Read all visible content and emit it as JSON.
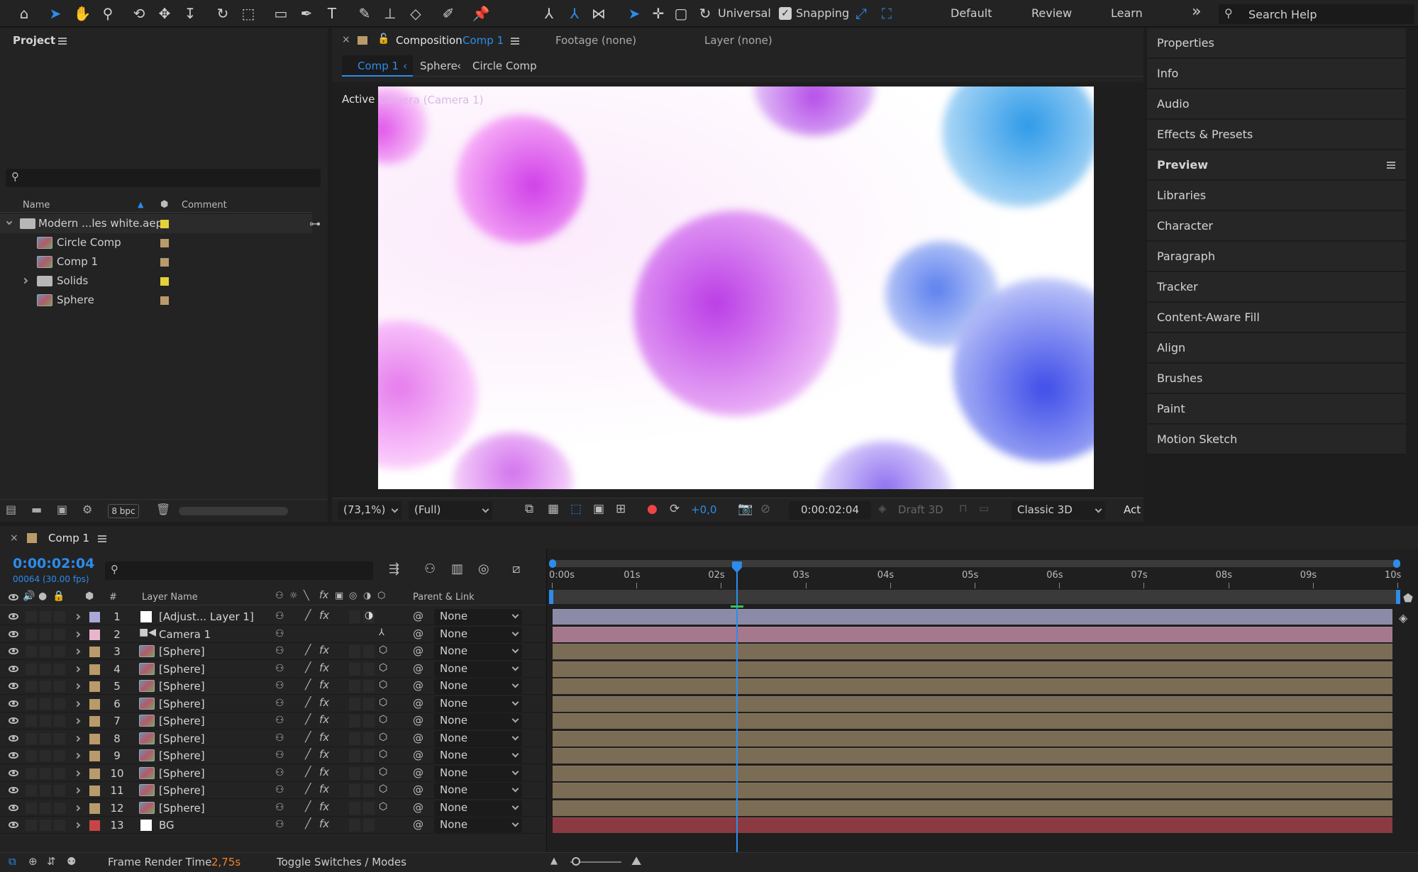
{
  "toolbar": {
    "universal_label": "Universal",
    "snapping_label": "Snapping",
    "workspaces": [
      "Default",
      "Review",
      "Learn"
    ],
    "overflow": "»",
    "search_placeholder": "Search Help"
  },
  "project": {
    "title": "Project",
    "col_name": "Name",
    "col_comment": "Comment",
    "items": [
      {
        "name": "Modern ...les white.aep",
        "type": "folder",
        "color": "#e3d23a"
      },
      {
        "name": "Circle Comp",
        "type": "comp",
        "color": "#b99b6b"
      },
      {
        "name": "Comp 1",
        "type": "comp",
        "color": "#b99b6b"
      },
      {
        "name": "Solids",
        "type": "folder",
        "color": "#e3d23a"
      },
      {
        "name": "Sphere",
        "type": "comp",
        "color": "#b99b6b"
      }
    ],
    "bpc": "8 bpc"
  },
  "viewer": {
    "tab_composition": "Composition",
    "tab_comp_name": "Comp 1",
    "tab_footage": "Footage (none)",
    "tab_layer": "Layer (none)",
    "breadcrumbs": [
      "Comp 1",
      "Sphere",
      "Circle Comp"
    ],
    "active_label_prefix": "Active ",
    "active_label_rest": "Camera (Camera 1)",
    "zoom": "(73,1%)",
    "resolution": "(Full)",
    "exposure": "+0,0",
    "timecode": "0:00:02:04",
    "draft3d": "Draft 3D",
    "renderer": "Classic 3D",
    "view_trunc": "Act"
  },
  "right_panel": {
    "items": [
      "Properties",
      "Info",
      "Audio",
      "Effects & Presets",
      "Preview",
      "Libraries",
      "Character",
      "Paragraph",
      "Tracker",
      "Content-Aware Fill",
      "Align",
      "Brushes",
      "Paint",
      "Motion Sketch"
    ]
  },
  "timeline": {
    "comp_name": "Comp 1",
    "timecode": "0:00:02:04",
    "frame_info": "00064 (30.00 fps)",
    "col_hash": "#",
    "col_layer_name": "Layer Name",
    "col_parent": "Parent & Link",
    "ruler": [
      "0:00s",
      "01s",
      "02s",
      "03s",
      "04s",
      "05s",
      "06s",
      "07s",
      "08s",
      "09s",
      "10s"
    ],
    "playhead_fraction": 0.218,
    "layers": [
      {
        "num": "1",
        "name": "[Adjust... Layer 1]",
        "label": "#a9a9d8",
        "kind": "adjust",
        "bar": "#8b8ba8",
        "parent": "None"
      },
      {
        "num": "2",
        "name": "Camera 1",
        "label": "#e8b5cc",
        "kind": "camera",
        "bar": "#a5788e",
        "parent": "None"
      },
      {
        "num": "3",
        "name": "[Sphere]",
        "label": "#b99b6b",
        "kind": "comp",
        "bar": "#7b6c55",
        "parent": "None"
      },
      {
        "num": "4",
        "name": "[Sphere]",
        "label": "#b99b6b",
        "kind": "comp",
        "bar": "#7b6c55",
        "parent": "None"
      },
      {
        "num": "5",
        "name": "[Sphere]",
        "label": "#b99b6b",
        "kind": "comp",
        "bar": "#7b6c55",
        "parent": "None"
      },
      {
        "num": "6",
        "name": "[Sphere]",
        "label": "#b99b6b",
        "kind": "comp",
        "bar": "#7b6c55",
        "parent": "None"
      },
      {
        "num": "7",
        "name": "[Sphere]",
        "label": "#b99b6b",
        "kind": "comp",
        "bar": "#7b6c55",
        "parent": "None"
      },
      {
        "num": "8",
        "name": "[Sphere]",
        "label": "#b99b6b",
        "kind": "comp",
        "bar": "#7b6c55",
        "parent": "None"
      },
      {
        "num": "9",
        "name": "[Sphere]",
        "label": "#b99b6b",
        "kind": "comp",
        "bar": "#7b6c55",
        "parent": "None"
      },
      {
        "num": "10",
        "name": "[Sphere]",
        "label": "#b99b6b",
        "kind": "comp",
        "bar": "#7b6c55",
        "parent": "None"
      },
      {
        "num": "11",
        "name": "[Sphere]",
        "label": "#b99b6b",
        "kind": "comp",
        "bar": "#7b6c55",
        "parent": "None"
      },
      {
        "num": "12",
        "name": "[Sphere]",
        "label": "#b99b6b",
        "kind": "comp",
        "bar": "#7b6c55",
        "parent": "None"
      },
      {
        "num": "13",
        "name": "BG",
        "label": "#c94545",
        "kind": "solid",
        "bar": "#8a3a40",
        "parent": "None"
      }
    ],
    "frame_render_label": "Frame Render Time",
    "frame_render_value": "2,75s",
    "toggle_label": "Toggle Switches / Modes"
  }
}
